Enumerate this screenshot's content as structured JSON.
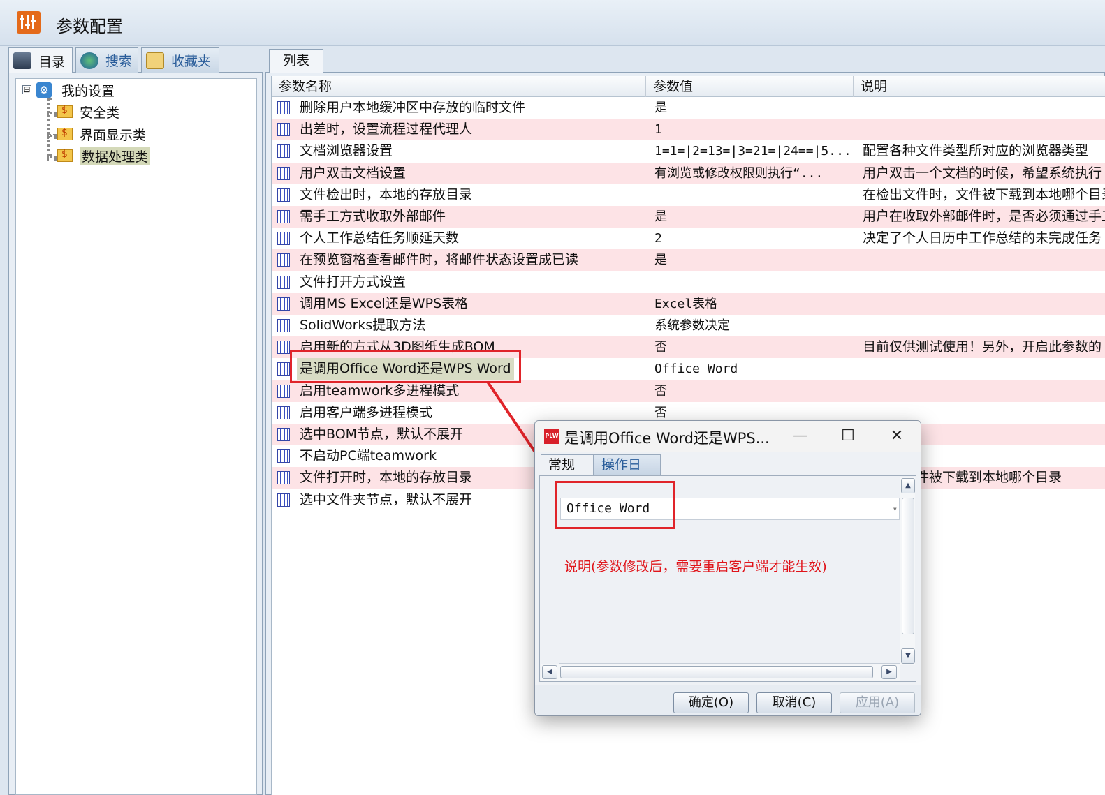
{
  "window": {
    "title": "参数配置"
  },
  "left_tabs": [
    {
      "label": "目录",
      "icon": "computer-icon"
    },
    {
      "label": "搜索",
      "icon": "globe-search-icon"
    },
    {
      "label": "收藏夹",
      "icon": "favorites-folder-icon"
    }
  ],
  "tree": {
    "root": "我的设置",
    "expander": "⊟",
    "children": [
      "安全类",
      "界面显示类",
      "数据处理类"
    ],
    "selected": "数据处理类"
  },
  "right_tab": "列表",
  "grid": {
    "columns": [
      "参数名称",
      "参数值",
      "说明"
    ],
    "rows": [
      {
        "name": "删除用户本地缓冲区中存放的临时文件",
        "value": "是",
        "desc": ""
      },
      {
        "name": "出差时，设置流程过程代理人",
        "value": "1",
        "desc": ""
      },
      {
        "name": "文档浏览器设置",
        "value": "1=1=|2=13=|3=21=|24==|5...",
        "desc": "配置各种文件类型所对应的浏览器类型"
      },
      {
        "name": "用户双击文档设置",
        "value": "有浏览或修改权限则执行“...",
        "desc": "用户双击一个文档的时候，希望系统执行"
      },
      {
        "name": "文件检出时，本地的存放目录",
        "value": "",
        "desc": "在检出文件时，文件被下载到本地哪个目录"
      },
      {
        "name": "需手工方式收取外部邮件",
        "value": "是",
        "desc": "用户在收取外部邮件时，是否必须通过手工"
      },
      {
        "name": "个人工作总结任务顺延天数",
        "value": "2",
        "desc": "决定了个人日历中工作总结的未完成任务"
      },
      {
        "name": "在预览窗格查看邮件时，将邮件状态设置成已读",
        "value": "是",
        "desc": ""
      },
      {
        "name": "文件打开方式设置",
        "value": "",
        "desc": ""
      },
      {
        "name": "调用MS Excel还是WPS表格",
        "value": "Excel表格",
        "desc": ""
      },
      {
        "name": "SolidWorks提取方法",
        "value": "系统参数决定",
        "desc": ""
      },
      {
        "name": "启用新的方式从3D图纸生成BOM",
        "value": "否",
        "desc": "目前仅供测试使用！另外，开启此参数的"
      },
      {
        "name": "是调用Office Word还是WPS Word",
        "value": "Office Word",
        "desc": ""
      },
      {
        "name": "启用teamwork多进程模式",
        "value": "否",
        "desc": ""
      },
      {
        "name": "启用客户端多进程模式",
        "value": "否",
        "desc": ""
      },
      {
        "name": "选中BOM节点，默认不展开",
        "value": "",
        "desc": ""
      },
      {
        "name": "不启动PC端teamwork",
        "value": "",
        "desc": ""
      },
      {
        "name": "文件打开时，本地的存放目录",
        "value": "",
        "desc": "件时，文件被下载到本地哪个目录"
      },
      {
        "name": "选中文件夹节点，默认不展开",
        "value": "",
        "desc": ""
      }
    ]
  },
  "dialog": {
    "icon_text": "PLW",
    "title": "是调用Office Word还是WPS...",
    "minimize": "—",
    "maximize": "☐",
    "close": "✕",
    "tabs": [
      "常规",
      "操作日志"
    ],
    "value": "Office Word",
    "description": "说明(参数修改后，需要重启客户端才能生效)",
    "buttons": [
      "确定(O)",
      "取消(C)",
      "应用(A)"
    ]
  },
  "colors": {
    "highlight": "#e0242a",
    "row_alt": "#fde3e6",
    "app_icon": "#e46a1a"
  }
}
